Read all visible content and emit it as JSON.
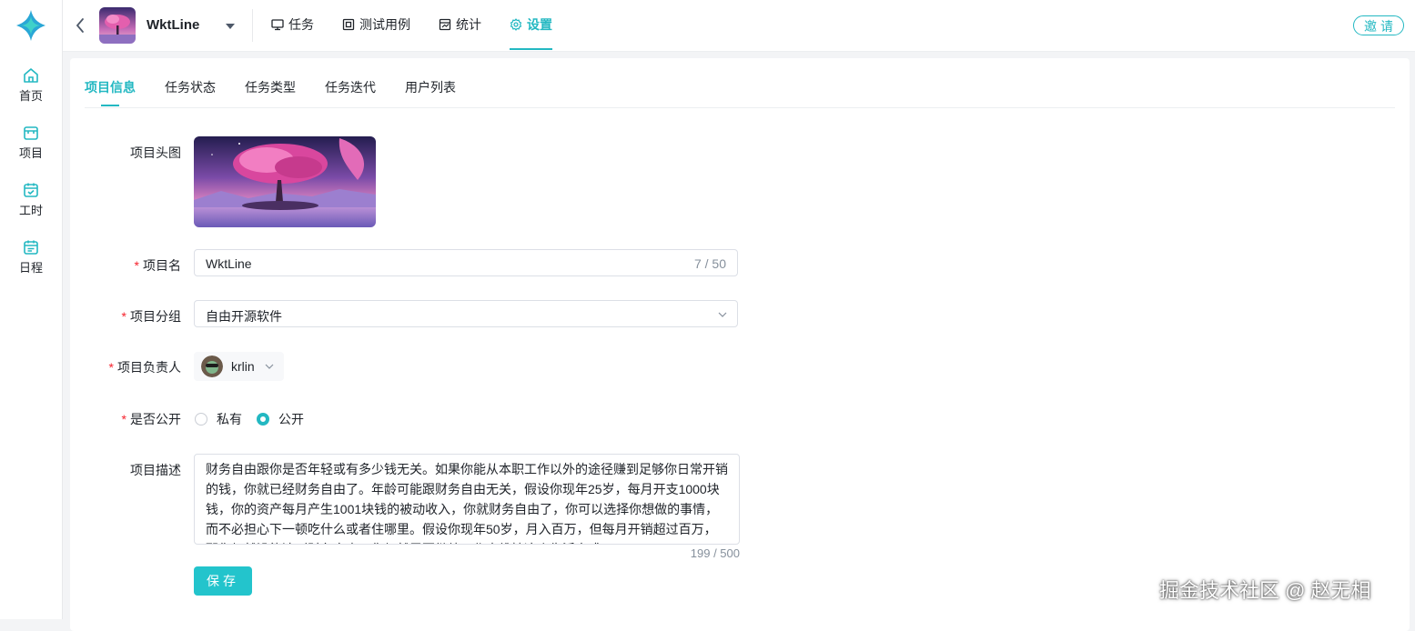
{
  "sidebar": {
    "items": [
      {
        "label": "首页",
        "icon": "home-icon"
      },
      {
        "label": "项目",
        "icon": "project-icon"
      },
      {
        "label": "工时",
        "icon": "calendar-check-icon"
      },
      {
        "label": "日程",
        "icon": "schedule-icon"
      }
    ]
  },
  "header": {
    "project_name": "WktLine",
    "tabs": [
      {
        "label": "任务",
        "icon": "monitor-icon"
      },
      {
        "label": "测试用例",
        "icon": "testcase-icon"
      },
      {
        "label": "统计",
        "icon": "chart-icon"
      },
      {
        "label": "设置",
        "icon": "gear-icon",
        "active": true
      }
    ],
    "invite_label": "邀请"
  },
  "settings": {
    "subtabs": [
      "项目信息",
      "任务状态",
      "任务类型",
      "任务迭代",
      "用户列表"
    ],
    "active_subtab": "项目信息",
    "form": {
      "avatar_label": "项目头图",
      "name_label": "项目名",
      "name_value": "WktLine",
      "name_count": "7 / 50",
      "group_label": "项目分组",
      "group_value": "自由开源软件",
      "owner_label": "项目负责人",
      "owner_name": "krlin",
      "public_label": "是否公开",
      "radio_private": "私有",
      "radio_public": "公开",
      "public_selected": "公开",
      "desc_label": "项目描述",
      "desc_value": "财务自由跟你是否年轻或有多少钱无关。如果你能从本职工作以外的途径赚到足够你日常开销的钱，你就已经财务自由了。年龄可能跟财务自由无关，假设你现年25岁，每月开支1000块钱，你的资产每月产生1001块钱的被动收入，你就财务自由了，你可以选择你想做的事情，而不必担心下一顿吃什么或者住哪里。假设你现年50岁，月入百万，但每月开销超过百万，那你仍然没能达到财务自由，你仍然需要继续工作来维持这个生活方式。",
      "desc_count": "199 / 500",
      "save_label": "保存"
    }
  },
  "credit": "掘金技术社区 @ 赵无相",
  "colors": {
    "accent": "#23b8c2",
    "required": "#f5222d"
  }
}
